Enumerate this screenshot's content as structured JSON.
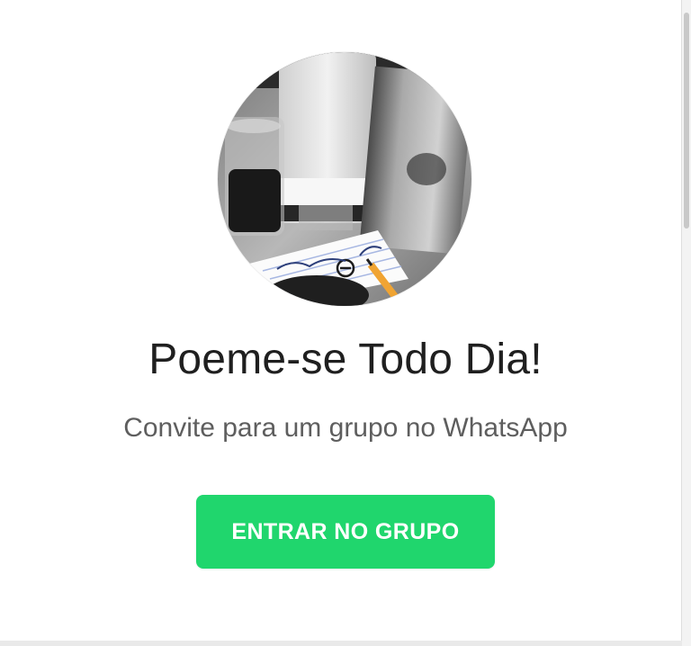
{
  "invite": {
    "group_name": "Poeme-se Todo Dia!",
    "subtitle": "Convite para um grupo no WhatsApp",
    "join_button_label": "ENTRAR NO GRUPO",
    "avatar_icon": "group-photo-icon"
  },
  "colors": {
    "accent": "#20d66d",
    "title": "#1f1f1f",
    "subtitle": "#5e5e5e",
    "background": "#ffffff"
  }
}
